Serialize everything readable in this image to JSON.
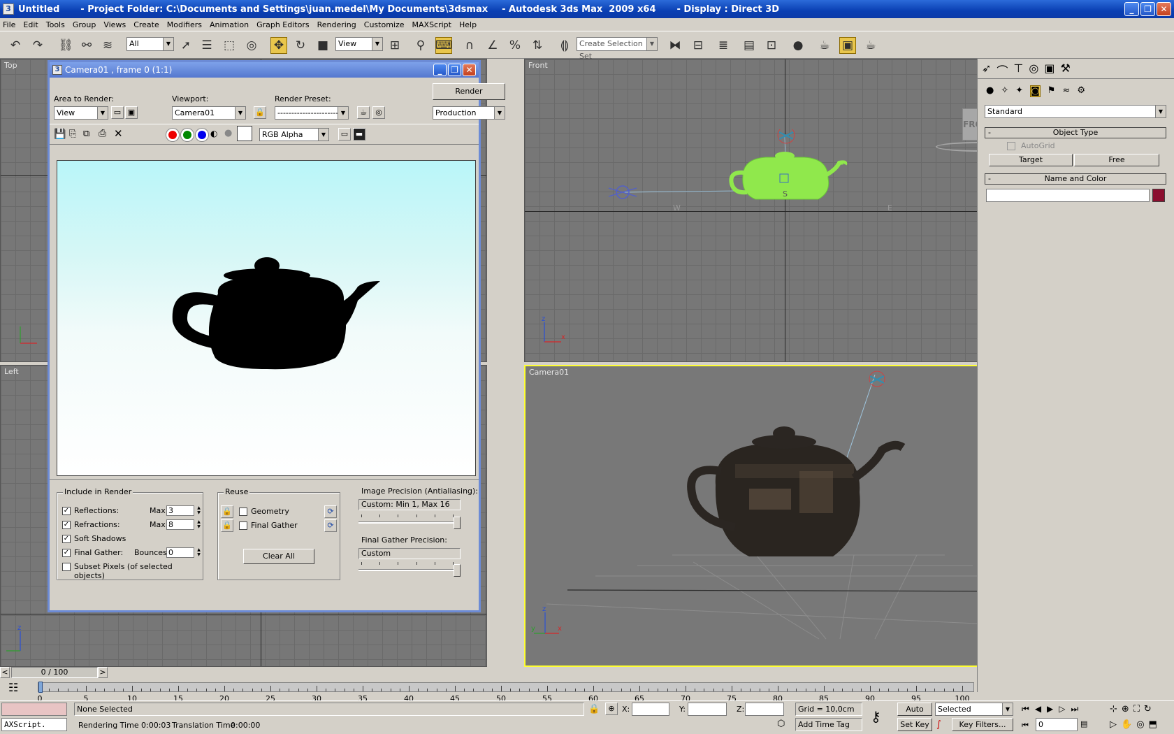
{
  "window": {
    "title_doc": "Untitled",
    "title_project": "- Project Folder: C:\\Documents and Settings\\juan.medel\\My Documents\\3dsmax",
    "title_app": "- Autodesk 3ds Max  2009 x64",
    "title_display": "- Display : Direct 3D",
    "app_icon": "3",
    "min": "_",
    "max": "❐",
    "close": "✕"
  },
  "menu": [
    "File",
    "Edit",
    "Tools",
    "Group",
    "Views",
    "Create",
    "Modifiers",
    "Animation",
    "Graph Editors",
    "Rendering",
    "Customize",
    "MAXScript",
    "Help"
  ],
  "toolbar": {
    "filter_value": "All",
    "refcoord_value": "View",
    "selection_set_placeholder": "Create Selection Set",
    "icons": [
      "undo-icon",
      "redo-icon",
      "select-link-icon",
      "unlink-icon",
      "bind-spacewarp-icon",
      "select-object-icon",
      "select-by-name-icon",
      "rect-region-icon",
      "window-crossing-icon",
      "move-icon",
      "rotate-icon",
      "scale-icon",
      "pivot-icon",
      "manipulate-icon",
      "keyboard-shortcut-icon",
      "snap-icon",
      "angle-snap-icon",
      "percent-snap-icon",
      "spinner-snap-icon",
      "edit-named-sets-icon",
      "mirror-icon",
      "align-icon",
      "layer-manager-icon",
      "curve-editor-icon",
      "schematic-view-icon",
      "material-editor-icon",
      "render-setup-icon",
      "rendered-frame-window-icon",
      "quick-render-icon"
    ]
  },
  "viewports": {
    "top_label": "Top",
    "front_label": "Front",
    "left_label": "Left",
    "camera_label": "Camera01",
    "viewcube_label": "FRONT",
    "axis_x": "x",
    "axis_y": "y",
    "axis_z": "z",
    "front_marks": {
      "w": "W",
      "s": "S",
      "e": "E"
    }
  },
  "render_window": {
    "title": "Camera01 , frame 0 (1:1)",
    "area_to_render_label": "Area to Render:",
    "area_to_render_value": "View",
    "viewport_label": "Viewport:",
    "viewport_value": "Camera01",
    "render_preset_label": "Render Preset:",
    "render_preset_value": "-------------------------",
    "render_button": "Render",
    "production_value": "Production",
    "channel_value": "RGB Alpha",
    "include_label": "Include in Render",
    "reflections_label": "Reflections:",
    "reflections_max_label": "Max:",
    "reflections_max": "3",
    "refractions_label": "Refractions:",
    "refractions_max_label": "Max:",
    "refractions_max": "8",
    "soft_shadows_label": "Soft Shadows",
    "final_gather_label": "Final Gather:",
    "bounces_label": "Bounces:",
    "bounces_value": "0",
    "subset_pixels_label": "Subset Pixels (of selected objects)",
    "reuse_label": "Reuse",
    "geometry_label": "Geometry",
    "final_gather_reuse_label": "Final Gather",
    "clear_all_button": "Clear All",
    "image_precision_label": "Image Precision (Antialiasing):",
    "image_precision_value": "Custom: Min 1, Max 16",
    "image_precision_level": 1.0,
    "fg_precision_label": "Final Gather Precision:",
    "fg_precision_value": "Custom",
    "fg_precision_level": 1.0,
    "checked_mark": "✓"
  },
  "command_panel": {
    "category_value": "Standard",
    "object_type_title": "Object Type",
    "autogrid_label": "AutoGrid",
    "target_button": "Target",
    "free_button": "Free",
    "name_color_title": "Name and Color",
    "name_value": "",
    "object_color": "#8b0e2e",
    "rollout_minus": "-"
  },
  "timeline": {
    "frame_display": "0 / 100",
    "prev": "<",
    "next": ">",
    "ticks": [
      "0",
      "5",
      "10",
      "15",
      "20",
      "25",
      "30",
      "35",
      "40",
      "45",
      "50",
      "55",
      "60",
      "65",
      "70",
      "75",
      "80",
      "85",
      "90",
      "95",
      "100"
    ]
  },
  "status": {
    "maxscript_label": "AXScript.",
    "selection_status": "None Selected",
    "render_time_label": "Rendering Time",
    "render_time": "0:00:03",
    "translation_time_label": "Translation Time",
    "translation_time": "0:00:00",
    "x_label": "X:",
    "y_label": "Y:",
    "z_label": "Z:",
    "x_value": "",
    "y_value": "",
    "z_value": "",
    "grid": "Grid = 10,0cm",
    "add_time_tag": "Add Time Tag",
    "auto_key": "Auto Key",
    "set_key": "Set Key",
    "selected_value": "Selected",
    "key_filters": "Key Filters...",
    "current_frame": "0"
  },
  "colors": {
    "active_viewport_border": "#ffff33",
    "selected_object": "#90e84c",
    "camera_icon": "#2f8fb3"
  }
}
